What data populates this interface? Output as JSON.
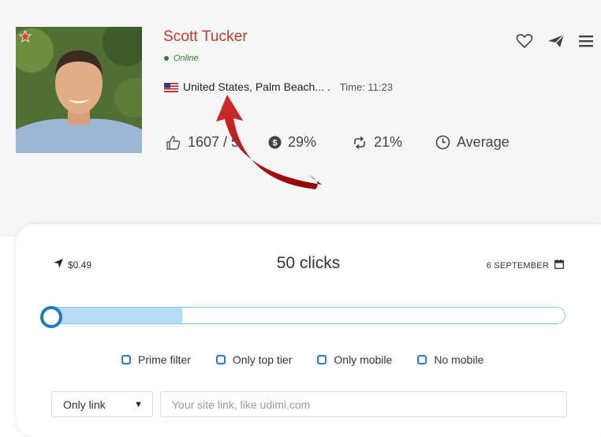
{
  "profile": {
    "name": "Scott Tucker",
    "status": "Online",
    "location": "United States, Palm Beach... .",
    "time": "Time: 11:23"
  },
  "stats": {
    "likes": "1607 / 5",
    "money": "29%",
    "repeat": "21%",
    "speed": "Average"
  },
  "order": {
    "price": "$0.49",
    "clicks": "50 clicks",
    "date": "6 SEPTEMBER",
    "slider_fraction": 0.26
  },
  "filters": [
    {
      "label": "Prime filter",
      "checked": false
    },
    {
      "label": "Only top tier",
      "checked": false
    },
    {
      "label": "Only mobile",
      "checked": false
    },
    {
      "label": "No mobile",
      "checked": false
    }
  ],
  "link_type": {
    "selected": "Only link"
  },
  "site_link": {
    "placeholder": "Your site link, like udimi.com",
    "value": ""
  },
  "colors": {
    "name": "#c0392b",
    "online": "#2e7d32",
    "accent": "#1f7ac4",
    "slider_fill": "#b9dcf6",
    "annotation_arrow": "#b71c1c"
  },
  "icons": [
    "star-icon",
    "heart-icon",
    "send-icon",
    "menu-icon",
    "thumbs-up-icon",
    "dollar-icon",
    "repeat-icon",
    "clock-icon",
    "navigation-icon",
    "calendar-icon",
    "caret-down-icon",
    "us-flag-icon"
  ]
}
